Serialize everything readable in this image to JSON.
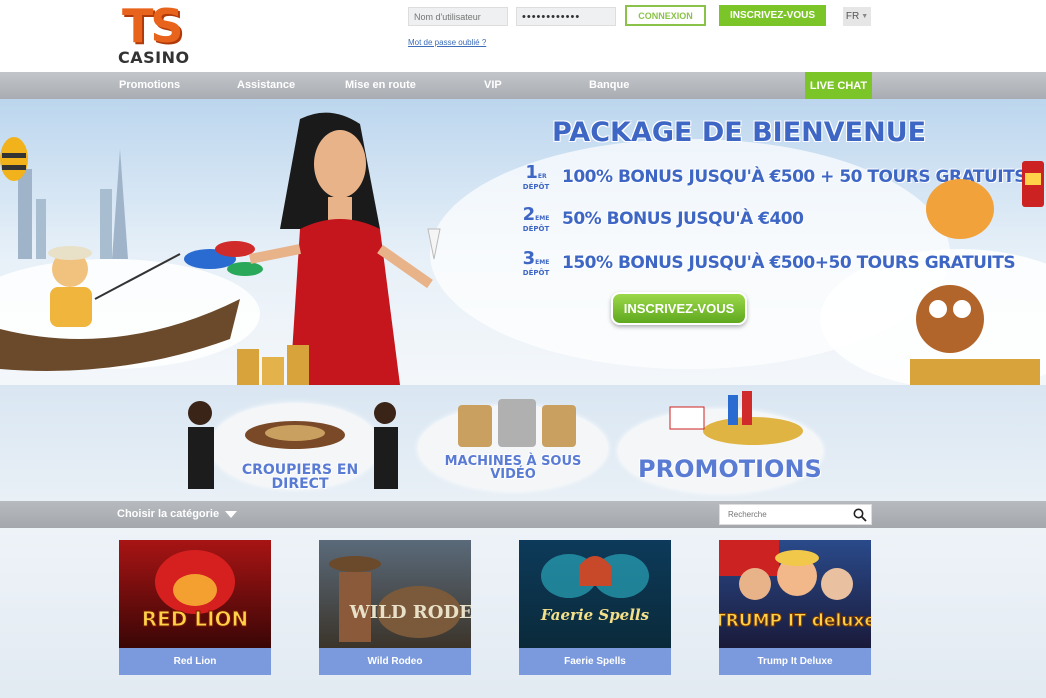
{
  "header": {
    "logo_top": "TS",
    "logo_bottom": "CASINO",
    "username_placeholder": "Nom d'utilisateur",
    "password_value": "••••••••••••",
    "forgot_label": "Mot de passe oublié ?",
    "login_label": "CONNEXION",
    "register_label": "INSCRIVEZ-VOUS",
    "language": "FR"
  },
  "nav": {
    "items": [
      {
        "label": "Promotions"
      },
      {
        "label": "Assistance"
      },
      {
        "label": "Mise en route"
      },
      {
        "label": "VIP"
      },
      {
        "label": "Banque"
      }
    ],
    "live_chat_label": "LIVE CHAT"
  },
  "hero": {
    "title": "PACKAGE DE BIENVENUE",
    "offers": [
      {
        "num": "1",
        "sup": "ER",
        "dep": "DÉPÔT",
        "text": "100% BONUS JUSQU'À €500 + 50 TOURS GRATUITS"
      },
      {
        "num": "2",
        "sup": "EME",
        "dep": "DÉPÔT",
        "text": "50% BONUS JUSQU'À €400"
      },
      {
        "num": "3",
        "sup": "EME",
        "dep": "DÉPÔT",
        "text": "150% BONUS JUSQU'À €500+50 TOURS GRATUITS"
      }
    ],
    "cta_label": "INSCRIVEZ-VOUS"
  },
  "categories": [
    {
      "label": "CROUPIERS EN DIRECT"
    },
    {
      "label": "MACHINES À SOUS VIDÉO"
    },
    {
      "label": "PROMOTIONS"
    }
  ],
  "catbar": {
    "label": "Choisir la catégorie",
    "search_placeholder": "Recherche"
  },
  "games": [
    {
      "name": "Red Lion",
      "title_art": "RED LION"
    },
    {
      "name": "Wild Rodeo",
      "title_art": "WILD RODEO"
    },
    {
      "name": "Faerie Spells",
      "title_art": "Faerie Spells"
    },
    {
      "name": "Trump It Deluxe",
      "title_art": "TRUMP IT deluxe"
    }
  ],
  "colors": {
    "accent_green": "#7cc529",
    "nav_gray": "#b2b6bb",
    "brand_orange": "#e8641c",
    "banner_blue": "#3e66c4",
    "game_label_blue": "#7b9ade"
  }
}
